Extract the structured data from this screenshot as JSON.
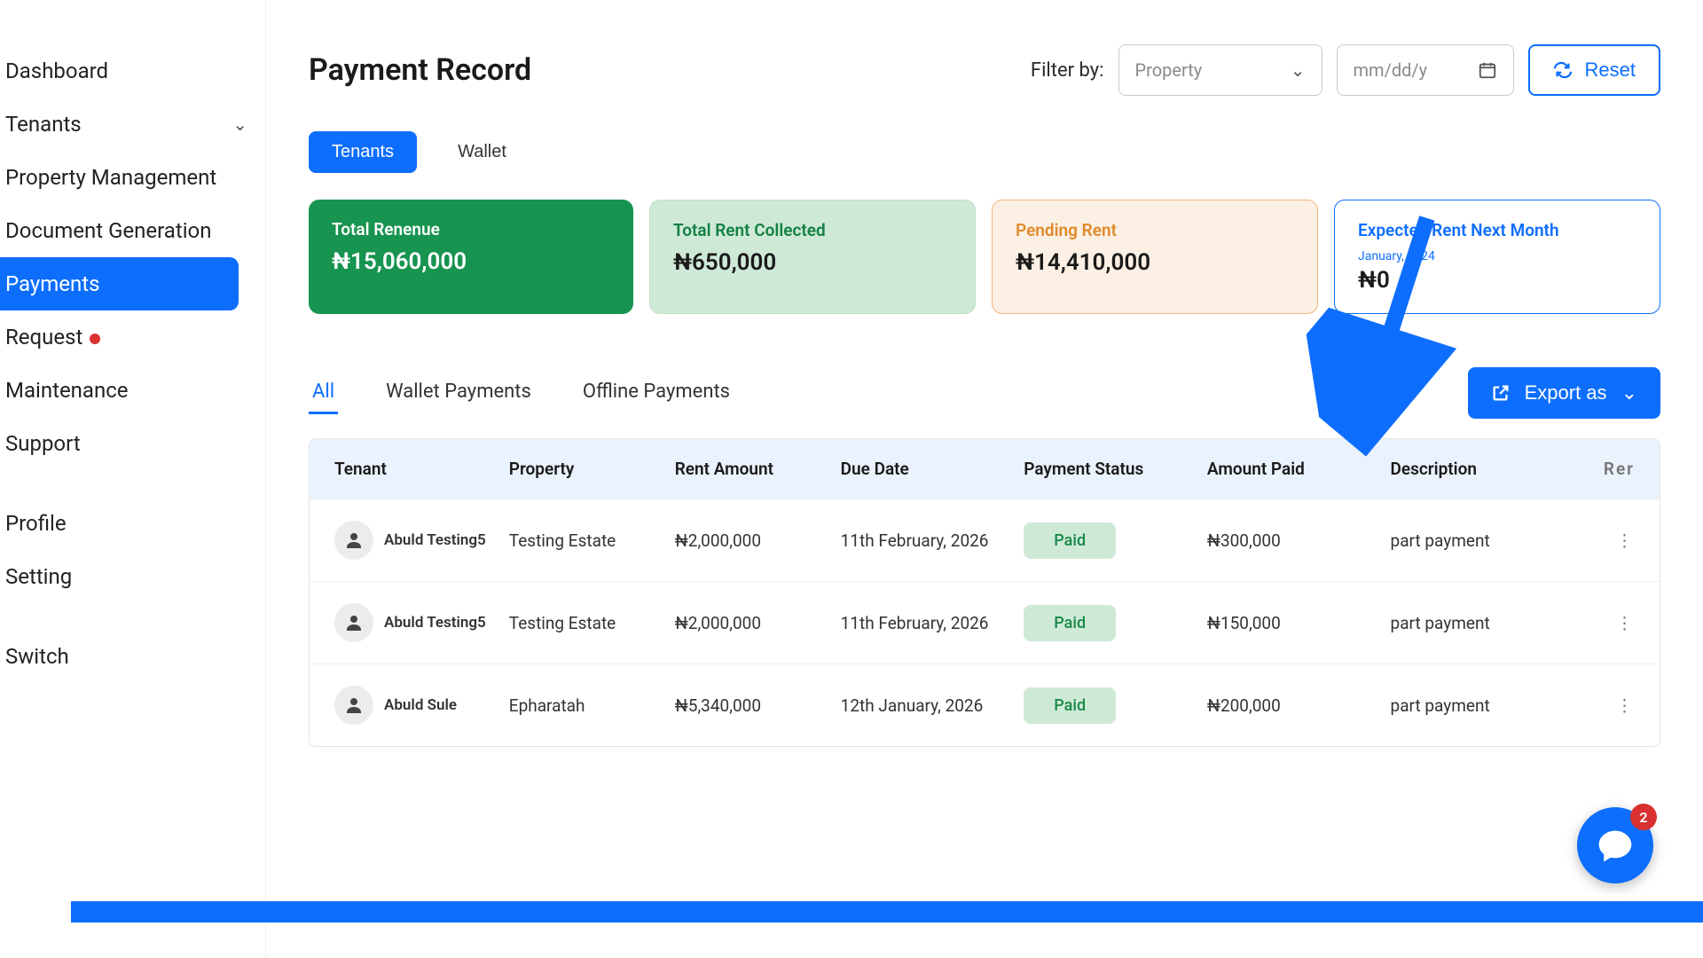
{
  "sidebar": {
    "items": [
      {
        "label": "Dashboard"
      },
      {
        "label": "Tenants"
      },
      {
        "label": "Property Management"
      },
      {
        "label": "Document Generation"
      },
      {
        "label": "Payments"
      },
      {
        "label": "Request"
      },
      {
        "label": "Maintenance"
      },
      {
        "label": "Support"
      },
      {
        "label": "Profile"
      },
      {
        "label": "Setting"
      },
      {
        "label": "Switch"
      }
    ]
  },
  "header": {
    "title": "Payment Record",
    "filter_label": "Filter by:",
    "property_placeholder": "Property",
    "date_placeholder": "mm/dd/y",
    "reset_label": "Reset"
  },
  "tabs": {
    "tenants": "Tenants",
    "wallet": "Wallet"
  },
  "cards": {
    "revenue": {
      "title": "Total Renenue",
      "value": "₦15,060,000"
    },
    "collected": {
      "title": "Total Rent Collected",
      "value": "₦650,000"
    },
    "pending": {
      "title": "Pending Rent",
      "value": "₦14,410,000"
    },
    "expected": {
      "title": "Expected Rent Next Month",
      "sub": "January, 2024",
      "value": "₦0"
    }
  },
  "subtabs": {
    "all": "All",
    "wallet": "Wallet Payments",
    "offline": "Offline Payments"
  },
  "export_label": "Export as",
  "table": {
    "headers": {
      "tenant": "Tenant",
      "property": "Property",
      "rent": "Rent Amount",
      "due": "Due Date",
      "status": "Payment Status",
      "amount": "Amount Paid",
      "desc": "Description",
      "last": "Rer"
    },
    "rows": [
      {
        "tenant": "Abuld Testing5",
        "property": "Testing Estate",
        "rent": "₦2,000,000",
        "due": "11th February, 2026",
        "status": "Paid",
        "amount": "₦300,000",
        "desc": "part payment"
      },
      {
        "tenant": "Abuld Testing5",
        "property": "Testing Estate",
        "rent": "₦2,000,000",
        "due": "11th February, 2026",
        "status": "Paid",
        "amount": "₦150,000",
        "desc": "part payment"
      },
      {
        "tenant": "Abuld Sule",
        "property": "Epharatah",
        "rent": "₦5,340,000",
        "due": "12th January, 2026",
        "status": "Paid",
        "amount": "₦200,000",
        "desc": "part payment"
      }
    ]
  },
  "chat": {
    "badge": "2"
  }
}
